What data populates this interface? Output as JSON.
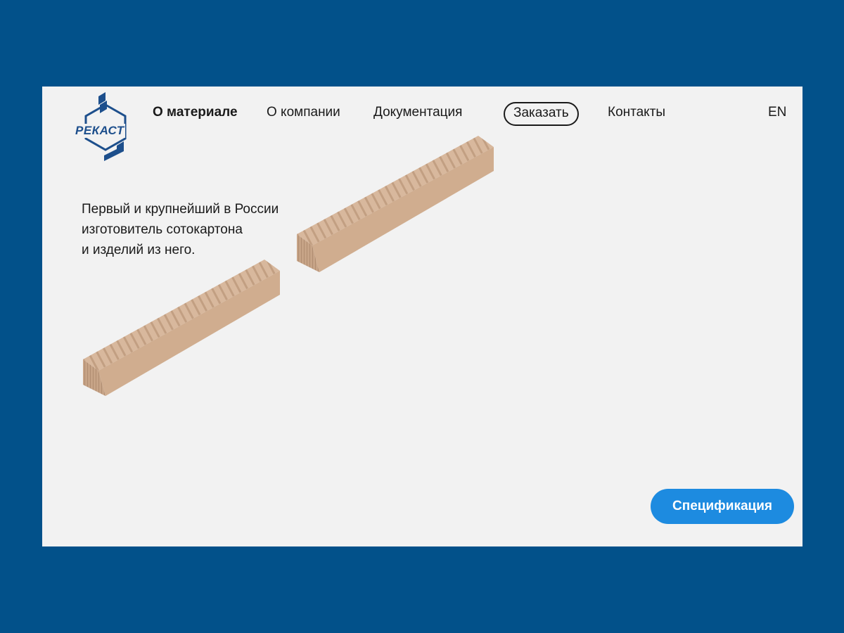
{
  "brand": {
    "logo_text": "РЕКАСТ",
    "accent_color": "#1d4f8c"
  },
  "nav": {
    "items": [
      {
        "label": "О материале",
        "active": true
      },
      {
        "label": "О компании"
      },
      {
        "label": "Документация"
      },
      {
        "label": "Заказать",
        "outlined": true
      },
      {
        "label": "Контакты"
      }
    ],
    "lang": "EN"
  },
  "hero": {
    "line1": "Первый и крупнейший в России",
    "line2": "изготовитель сотокартона",
    "line3": "и изделий из него."
  },
  "spec_button": {
    "label": "Спецификация",
    "color": "#1d8be0"
  },
  "colors": {
    "frame_bg": "#02518a",
    "page_bg": "#f2f2f2",
    "cardboard": "#d2b296"
  }
}
